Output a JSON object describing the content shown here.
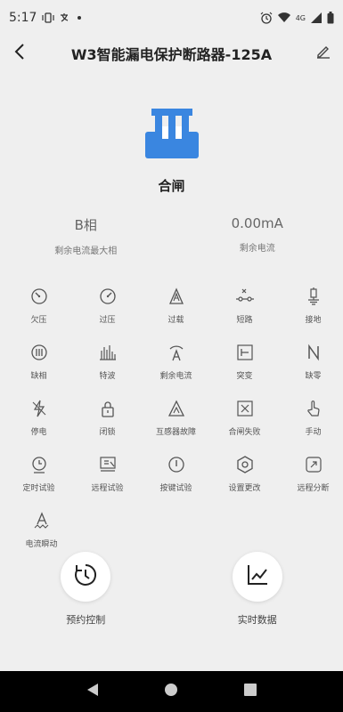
{
  "status_bar": {
    "time": "5:17",
    "network": "4G"
  },
  "header": {
    "title": "W3智能漏电保护断路器-125A"
  },
  "breaker": {
    "state": "合闸",
    "accent_color": "#3a86e0"
  },
  "stats": [
    {
      "value": "B相",
      "label": "剩余电流最大相"
    },
    {
      "value": "0.00mA",
      "label": "剩余电流"
    }
  ],
  "functions": {
    "row1": [
      {
        "label": "欠压",
        "icon": "gauge-low-icon"
      },
      {
        "label": "过压",
        "icon": "gauge-high-icon"
      },
      {
        "label": "过载",
        "icon": "overload-icon"
      },
      {
        "label": "短路",
        "icon": "short-circuit-icon"
      },
      {
        "label": "接地",
        "icon": "ground-icon"
      }
    ],
    "row2": [
      {
        "label": "缺相",
        "icon": "phase-loss-icon"
      },
      {
        "label": "特波",
        "icon": "harmonic-icon"
      },
      {
        "label": "剩余电流",
        "icon": "residual-current-icon"
      },
      {
        "label": "突变",
        "icon": "sudden-change-icon"
      },
      {
        "label": "缺零",
        "icon": "neutral-loss-icon"
      }
    ],
    "row3": [
      {
        "label": "停电",
        "icon": "power-outage-icon"
      },
      {
        "label": "闭锁",
        "icon": "lock-icon"
      },
      {
        "label": "互感器故障",
        "icon": "transformer-fault-icon"
      },
      {
        "label": "合闸失败",
        "icon": "close-fail-icon"
      },
      {
        "label": "手动",
        "icon": "hand-icon"
      }
    ],
    "row4": [
      {
        "label": "定时试验",
        "icon": "timer-test-icon"
      },
      {
        "label": "远程试验",
        "icon": "remote-test-icon"
      },
      {
        "label": "按键试验",
        "icon": "button-test-icon"
      },
      {
        "label": "设置更改",
        "icon": "settings-change-icon"
      },
      {
        "label": "远程分断",
        "icon": "remote-break-icon"
      }
    ],
    "row5": [
      {
        "label": "电流瞬动",
        "icon": "current-instant-icon"
      }
    ]
  },
  "actions": [
    {
      "label": "预约控制",
      "icon": "schedule-icon"
    },
    {
      "label": "实时数据",
      "icon": "chart-icon"
    }
  ]
}
